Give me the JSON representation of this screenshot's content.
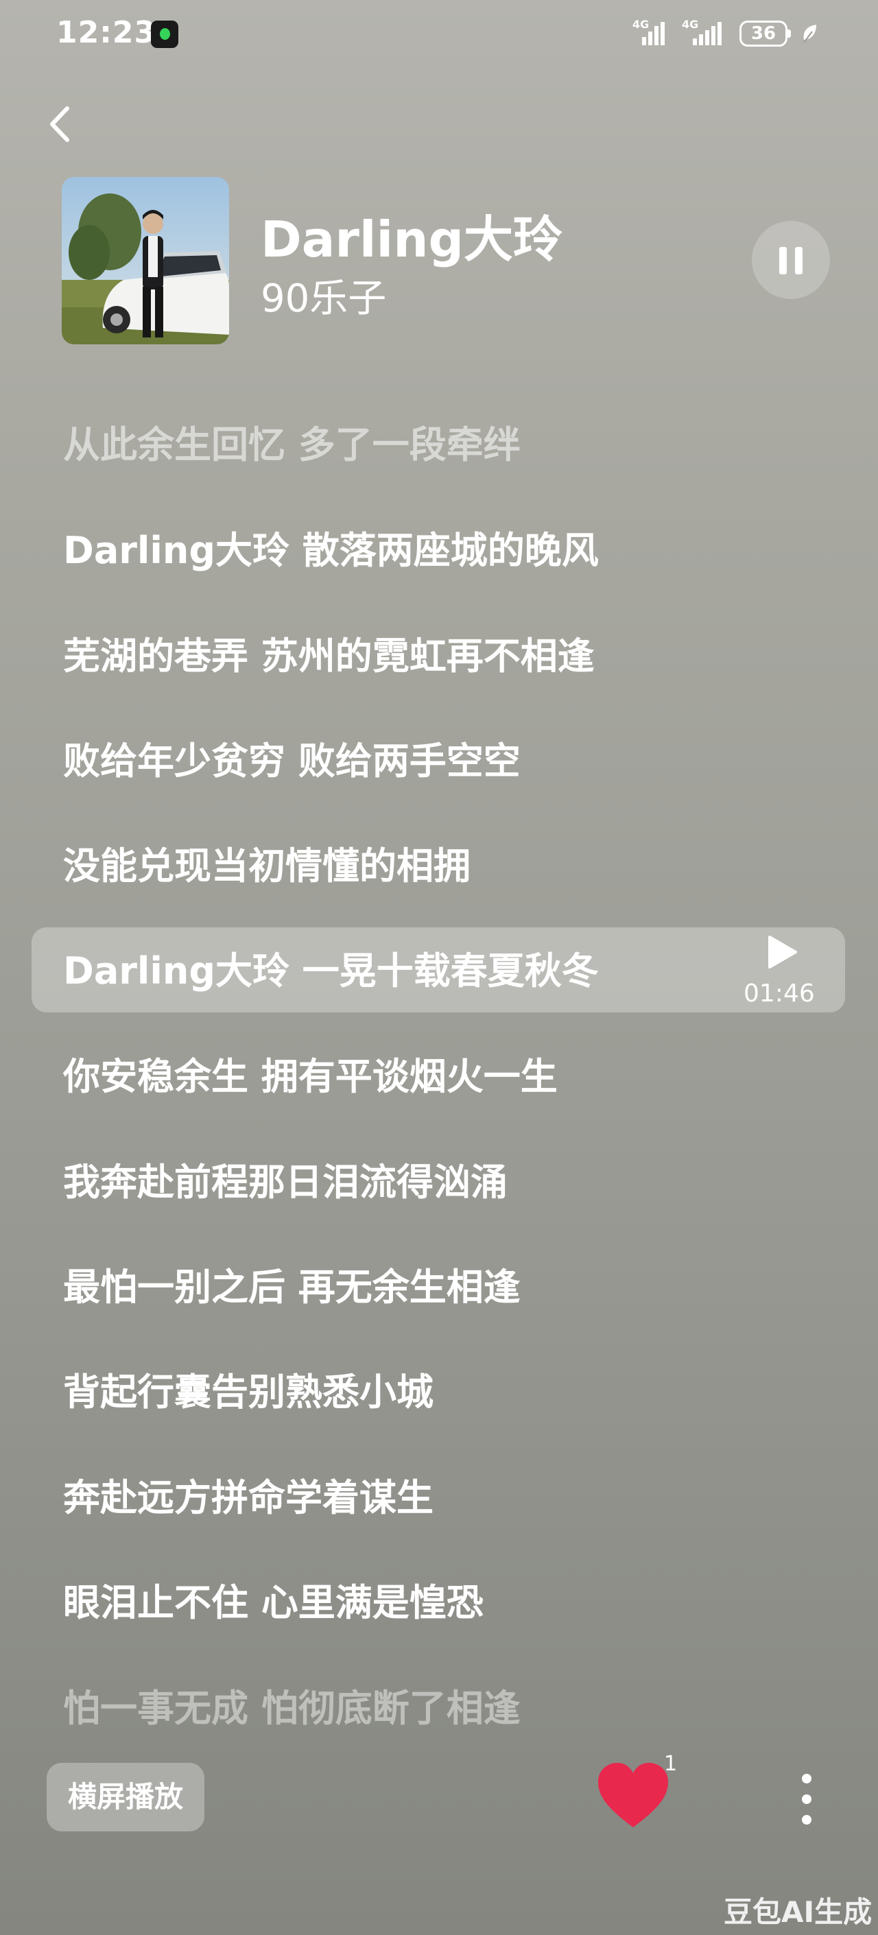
{
  "status_bar": {
    "time": "12:23",
    "signal_1": "4G",
    "signal_2": "4G",
    "battery": "36",
    "app_icon": "music-app-icon",
    "leaf_icon": "leaf-icon"
  },
  "header": {
    "back_icon": "chevron-left-icon",
    "song_title": "Darling大玲",
    "artist": "90乐子",
    "pause_icon": "pause-icon"
  },
  "lyrics": [
    "从此余生回忆 多了一段牵绊",
    "Darling大玲 散落两座城的晚风",
    "芜湖的巷弄 苏州的霓虹再不相逢",
    "败给年少贫穷 败给两手空空",
    "没能兑现当初情懂的相拥",
    "Darling大玲 一晃十载春夏秋冬",
    "你安稳余生 拥有平谈烟火一生",
    "我奔赴前程那日泪流得汹涌",
    "最怕一别之后 再无余生相逢",
    "背起行囊告别熟悉小城",
    "奔赴远方拼命学着谋生",
    "眼泪止不住 心里满是惶恐",
    "怕一事无成 怕彻底断了相逢"
  ],
  "highlight": {
    "seek_time": "01:46",
    "play_icon": "play-icon"
  },
  "bottom_bar": {
    "landscape_label": "横屏播放",
    "like_count": "1",
    "like_color": "#e8284d",
    "more_icon": "more-vertical-icon"
  },
  "watermark": "豆包AI生成"
}
